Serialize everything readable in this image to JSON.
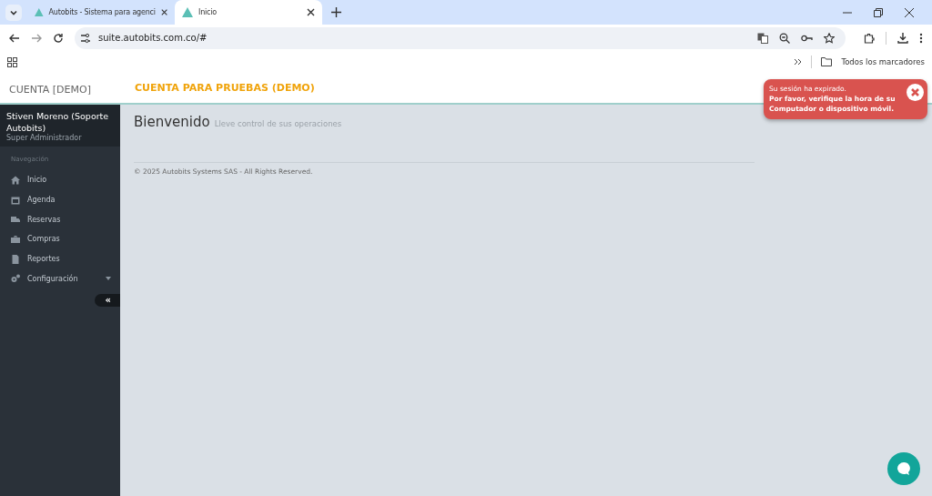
{
  "browser": {
    "tabs": [
      {
        "title": "Autobits - Sistema para agenci",
        "selected": false
      },
      {
        "title": "Inicio",
        "selected": true
      }
    ],
    "url": "suite.autobits.com.co/#",
    "bookmarks_label": "Todos los marcadores"
  },
  "header": {
    "brand": "CUENTA [DEMO]",
    "account": "CUENTA PARA PRUEBAS (DEMO)"
  },
  "sidebar": {
    "user_name": "Stiven Moreno (Soporte Autobits)",
    "user_role": "Super Administrador",
    "section": "Navegación",
    "items": [
      {
        "label": "Inicio",
        "submenu": false
      },
      {
        "label": "Agenda",
        "submenu": false
      },
      {
        "label": "Reservas",
        "submenu": false
      },
      {
        "label": "Compras",
        "submenu": false
      },
      {
        "label": "Reportes",
        "submenu": false
      },
      {
        "label": "Configuración",
        "submenu": true
      }
    ],
    "collapse": "«"
  },
  "page": {
    "title": "Bienvenido",
    "subtitle": "Lleve control de sus operaciones",
    "footer": "© 2025 Autobits Systems SAS - All Rights Reserved."
  },
  "toast": {
    "line1": "Su sesión ha expirado.",
    "line2": "Por favor, verifique la hora de su Computador o dispositivo móvil."
  }
}
